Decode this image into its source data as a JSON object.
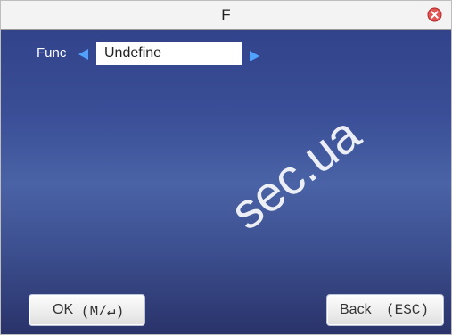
{
  "window": {
    "title": "F"
  },
  "func": {
    "label": "Func",
    "value": "Undefine"
  },
  "buttons": {
    "ok_label": "OK",
    "ok_key": "(M/↵)",
    "back_label": "Back",
    "back_key": "(ESC)"
  },
  "watermark": {
    "text": "sec.ua"
  },
  "colors": {
    "arrow": "#4fa3ff",
    "close": "#e53935"
  },
  "icons": {
    "close": "close-icon",
    "left": "left-arrow-icon",
    "right": "right-arrow-icon"
  }
}
